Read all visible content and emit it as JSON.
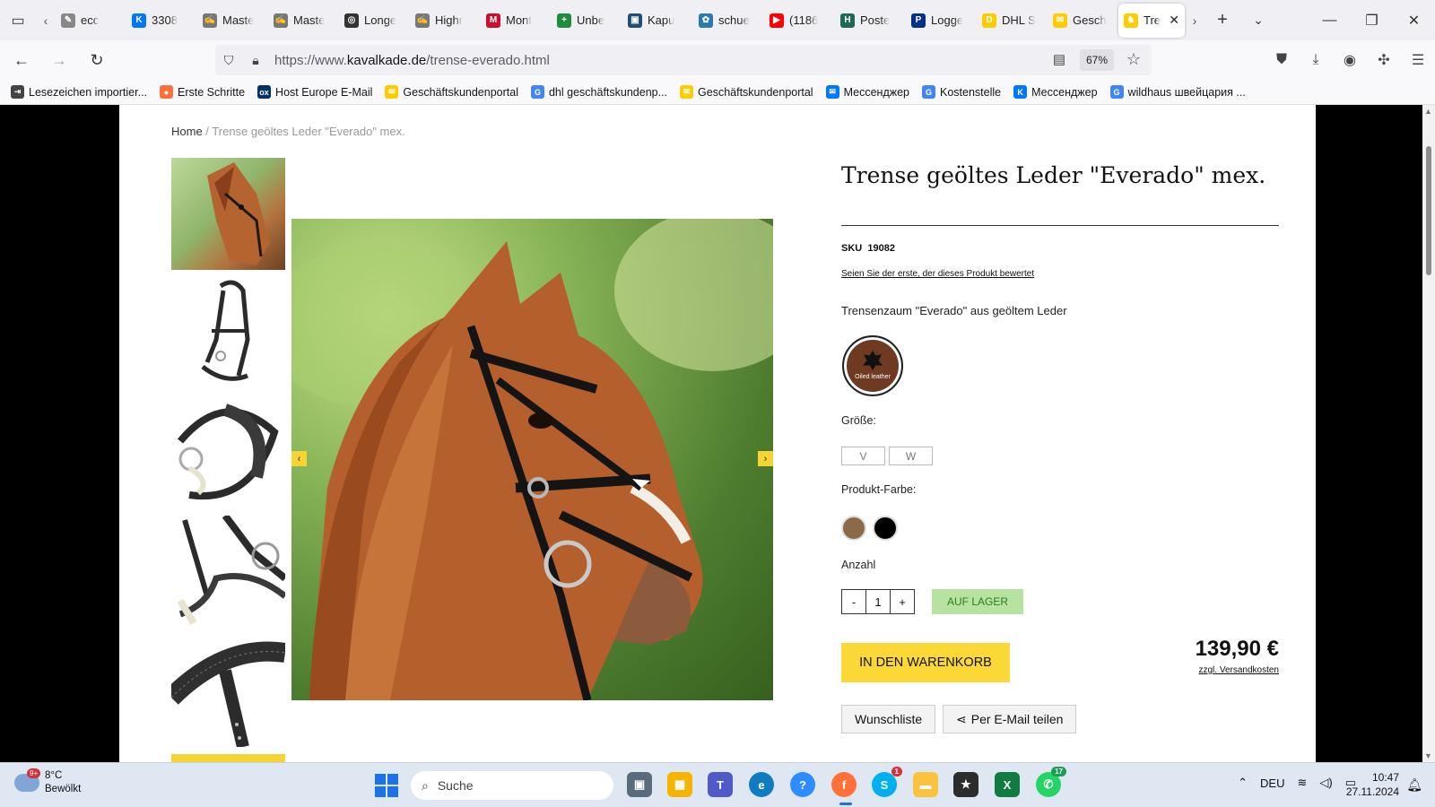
{
  "browser": {
    "tabs": [
      {
        "label": "ecc",
        "favicon": "pen-icon",
        "color": "#888888"
      },
      {
        "label": "3308",
        "favicon": "vk-icon",
        "color": "#0077ff"
      },
      {
        "label": "Maste",
        "favicon": "signature-icon",
        "color": "#777777"
      },
      {
        "label": "Maste",
        "favicon": "signature-icon",
        "color": "#777777"
      },
      {
        "label": "Longe",
        "favicon": "target-icon",
        "color": "#333333"
      },
      {
        "label": "Highr",
        "favicon": "signature-icon",
        "color": "#777777"
      },
      {
        "label": "Mont",
        "favicon": "m-icon",
        "color": "#c8102e"
      },
      {
        "label": "Unbe",
        "favicon": "plus-icon",
        "color": "#1e8e3e"
      },
      {
        "label": "Kapu",
        "favicon": "picture-icon",
        "color": "#1f4e79"
      },
      {
        "label": "schue",
        "favicon": "leaf-icon",
        "color": "#2a7ab0"
      },
      {
        "label": "(1186",
        "favicon": "youtube-icon",
        "color": "#ff0000"
      },
      {
        "label": "Poste",
        "favicon": "doc-icon",
        "color": "#1d6b57"
      },
      {
        "label": "Logge",
        "favicon": "paypal-icon",
        "color": "#003087"
      },
      {
        "label": "DHL S",
        "favicon": "dhl-icon",
        "color": "#ffcc00"
      },
      {
        "label": "Gesch",
        "favicon": "post-icon",
        "color": "#ffcc00"
      }
    ],
    "active_tab": {
      "label": "Tre",
      "favicon": "horse-icon",
      "color": "#ffcc00"
    },
    "url_prefix": "https://www.",
    "url_domain": "kavalkade.de",
    "url_path": "/trense-everado.html",
    "zoom": "67%",
    "bookmarks": [
      {
        "label": "Lesezeichen importier...",
        "icon": "import-icon",
        "color": "#444444"
      },
      {
        "label": "Erste Schritte",
        "icon": "firefox-icon",
        "color": "#ff7139"
      },
      {
        "label": "Host Europe E-Mail",
        "icon": "hosteurope-icon",
        "color": "#003366"
      },
      {
        "label": "Geschäftskundenportal",
        "icon": "post-icon",
        "color": "#ffcc00"
      },
      {
        "label": "dhl geschäftskundenp...",
        "icon": "google-icon",
        "color": "#4285f4"
      },
      {
        "label": "Geschäftskundenportal",
        "icon": "post-icon",
        "color": "#ffcc00"
      },
      {
        "label": "Мессенджер",
        "icon": "messenger-icon",
        "color": "#0077ff"
      },
      {
        "label": "Kostenstelle",
        "icon": "google-icon",
        "color": "#4285f4"
      },
      {
        "label": "Мессенджер",
        "icon": "vk-icon",
        "color": "#0077ff"
      },
      {
        "label": "wildhaus швейцария ...",
        "icon": "google-icon",
        "color": "#4285f4"
      }
    ]
  },
  "page": {
    "breadcrumb_home": "Home",
    "breadcrumb_sep": " / ",
    "breadcrumb_current": "Trense geöltes Leder \"Everado\" mex.",
    "product_name": "Trense geöltes Leder \"Everado\" mex.",
    "sku_label": "SKU",
    "sku_value": "19082",
    "review_link": "Seien Sie der erste, der dieses Produkt bewertet",
    "short_description": "Trensenzaum \"Everado\" aus geöltem Leder",
    "badge_text": "Oiled leather",
    "size_label": "Größe:",
    "sizes": [
      "V",
      "W"
    ],
    "color_label": "Produkt-Farbe:",
    "colors": [
      "#8a6a47",
      "#000000"
    ],
    "qty_label": "Anzahl",
    "qty_minus": "-",
    "qty_value": "1",
    "qty_plus": "+",
    "stock_status": "AUF LAGER",
    "add_to_cart": "IN DEN WARENKORB",
    "price": "139,90 €",
    "shipping_note": "zzgl. Versandkosten",
    "wishlist": "Wunschliste",
    "share_email": "Per E-Mail teilen"
  },
  "taskbar": {
    "weather_temp": "8°C",
    "weather_desc": "Bewölkt",
    "weather_badge": "9+",
    "search_placeholder": "Suche",
    "language": "DEU",
    "time": "10:47",
    "date": "27.11.2024",
    "skype_badge": "1",
    "whatsapp_badge": "17"
  }
}
